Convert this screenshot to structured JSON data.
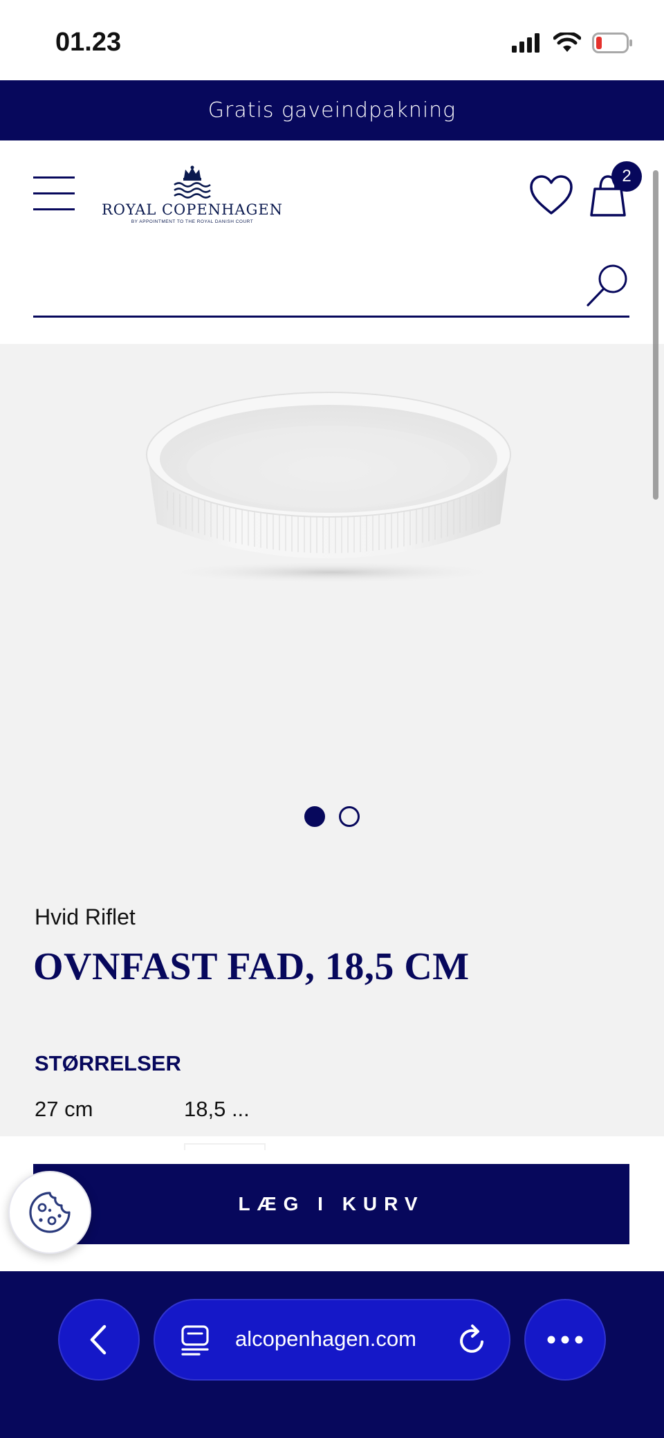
{
  "status_bar": {
    "time": "01.23",
    "icons": [
      "signal-icon",
      "wifi-icon",
      "battery-icon"
    ]
  },
  "promo": {
    "text": "Gratis gaveindpakning"
  },
  "header": {
    "logo_wordmark": "ROYAL COPENHAGEN",
    "logo_tagline": "BY APPOINTMENT TO THE ROYAL DANISH COURT",
    "cart_count": "2",
    "search_placeholder": ""
  },
  "gallery": {
    "image_count": 2,
    "active_index": 0
  },
  "product": {
    "collection": "Hvid Riflet",
    "title": "OVNFAST FAD, 18,5 CM",
    "sizes_heading": "STØRRELSER",
    "sizes": [
      "27 cm",
      "18,5 ..."
    ],
    "add_to_cart": "LÆG I KURV"
  },
  "browser": {
    "url": "alcopenhagen.com"
  },
  "colors": {
    "brand_navy": "#07085c",
    "browser_button": "#1518c8",
    "gallery_bg": "#f2f2f2"
  }
}
